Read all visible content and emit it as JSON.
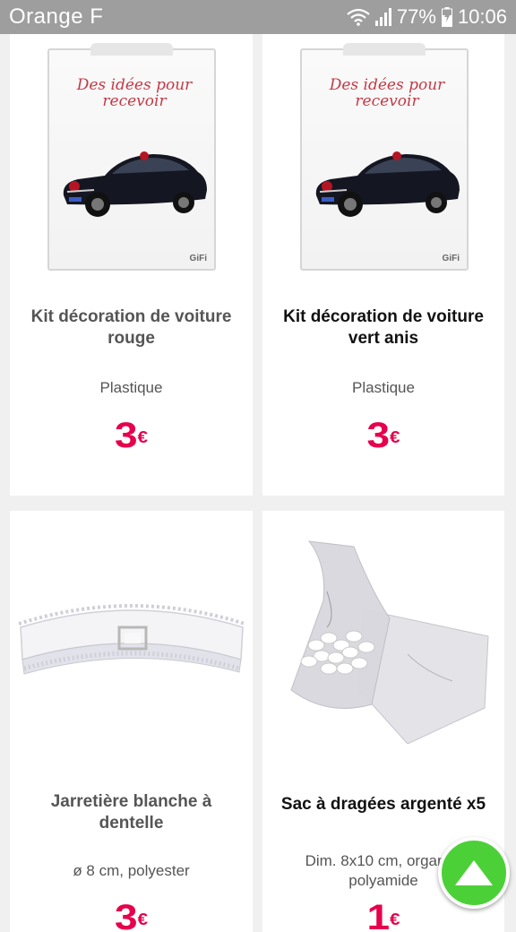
{
  "status": {
    "carrier": "Orange F",
    "battery": "77%",
    "time": "10:06"
  },
  "products": [
    {
      "title": "Kit décoration de voiture rouge",
      "material": "Plastique",
      "price": "3",
      "currency": "€",
      "package_text": "Des idées pour recevoir",
      "brand": "GiFi",
      "title_color": "#555555"
    },
    {
      "title": "Kit décoration de voiture vert anis",
      "material": "Plastique",
      "price": "3",
      "currency": "€",
      "package_text": "Des idées pour recevoir",
      "brand": "GiFi",
      "title_color": "#111111"
    },
    {
      "title": "Jarretière blanche à dentelle",
      "material": "ø 8 cm, polyester",
      "price": "3",
      "currency": "€",
      "title_color": "#555555"
    },
    {
      "title": "Sac à dragées argenté x5",
      "material": "Dim. 8x10 cm, organza polyamide",
      "price": "1",
      "currency": "€",
      "title_color": "#111111"
    }
  ],
  "accent_color": "#e6004d",
  "fab": {
    "icon": "arrow-up-icon",
    "color": "#4cd038"
  }
}
